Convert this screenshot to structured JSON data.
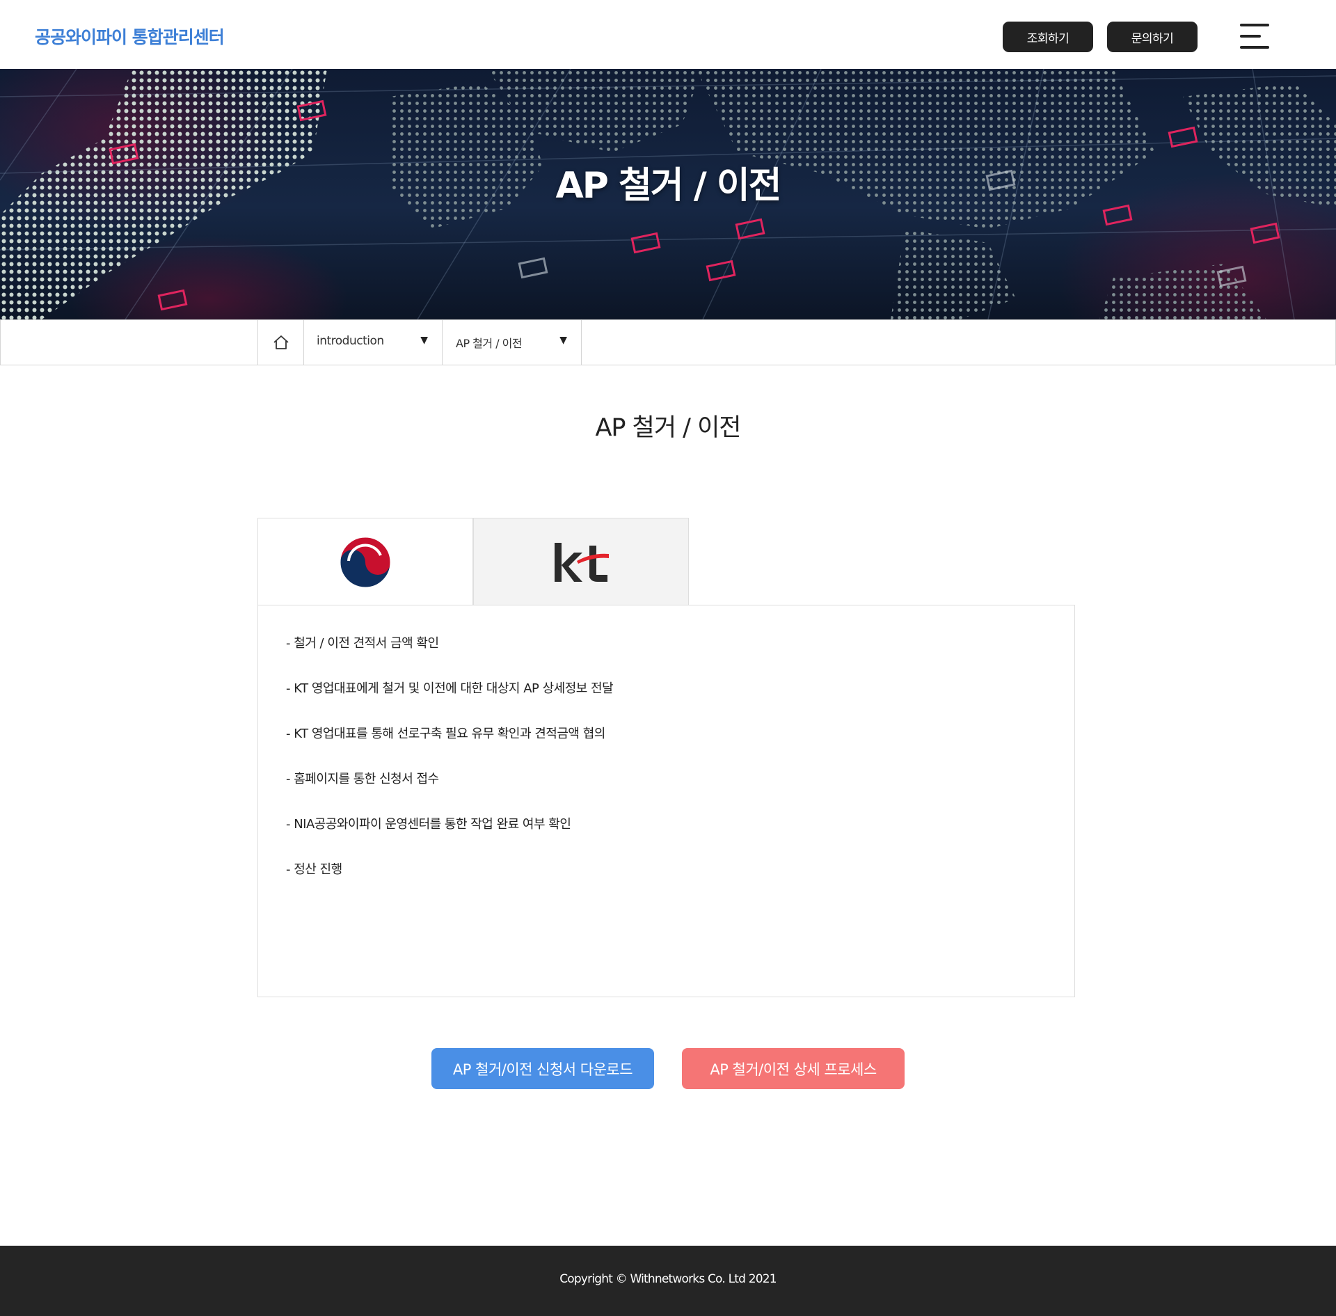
{
  "header": {
    "logo_text": "공공와이파이 통합관리센터",
    "buttons": [
      "조회하기",
      "문의하기"
    ]
  },
  "hero": {
    "title": "AP 철거 / 이전"
  },
  "breadcrumb": {
    "home_icon": "home-icon",
    "select1": "introduction",
    "select2": "AP 철거 / 이전"
  },
  "page_title": "AP 철거 / 이전",
  "tabs": [
    {
      "logo": "korea-government-emblem"
    },
    {
      "logo": "kt-logo"
    }
  ],
  "content": {
    "items": [
      "- 철거 / 이전 견적서 금액 확인",
      "- KT 영업대표에게 철거 및 이전에 대한 대상지 AP 상세정보 전달",
      "- KT 영업대표를 통해 선로구축 필요 유무 확인과 견적금액 협의",
      "- 홈페이지를 통한 신청서 접수",
      "- NIA공공와이파이 운영센터를 통한 작업 완료 여부 확인",
      "- 정산 진행"
    ]
  },
  "actions": {
    "download_label": "AP 철거/이전 신청서 다운로드",
    "process_label": "AP 철거/이전 상세 프로세스"
  },
  "footer": {
    "copyright": "Copyright © Withnetworks Co. Ltd 2021"
  },
  "colors": {
    "brand_blue": "#3d7fd6",
    "download_button": "#4a8fe6",
    "process_button": "#f57575",
    "footer_bg": "#252525",
    "header_button": "#222222"
  }
}
